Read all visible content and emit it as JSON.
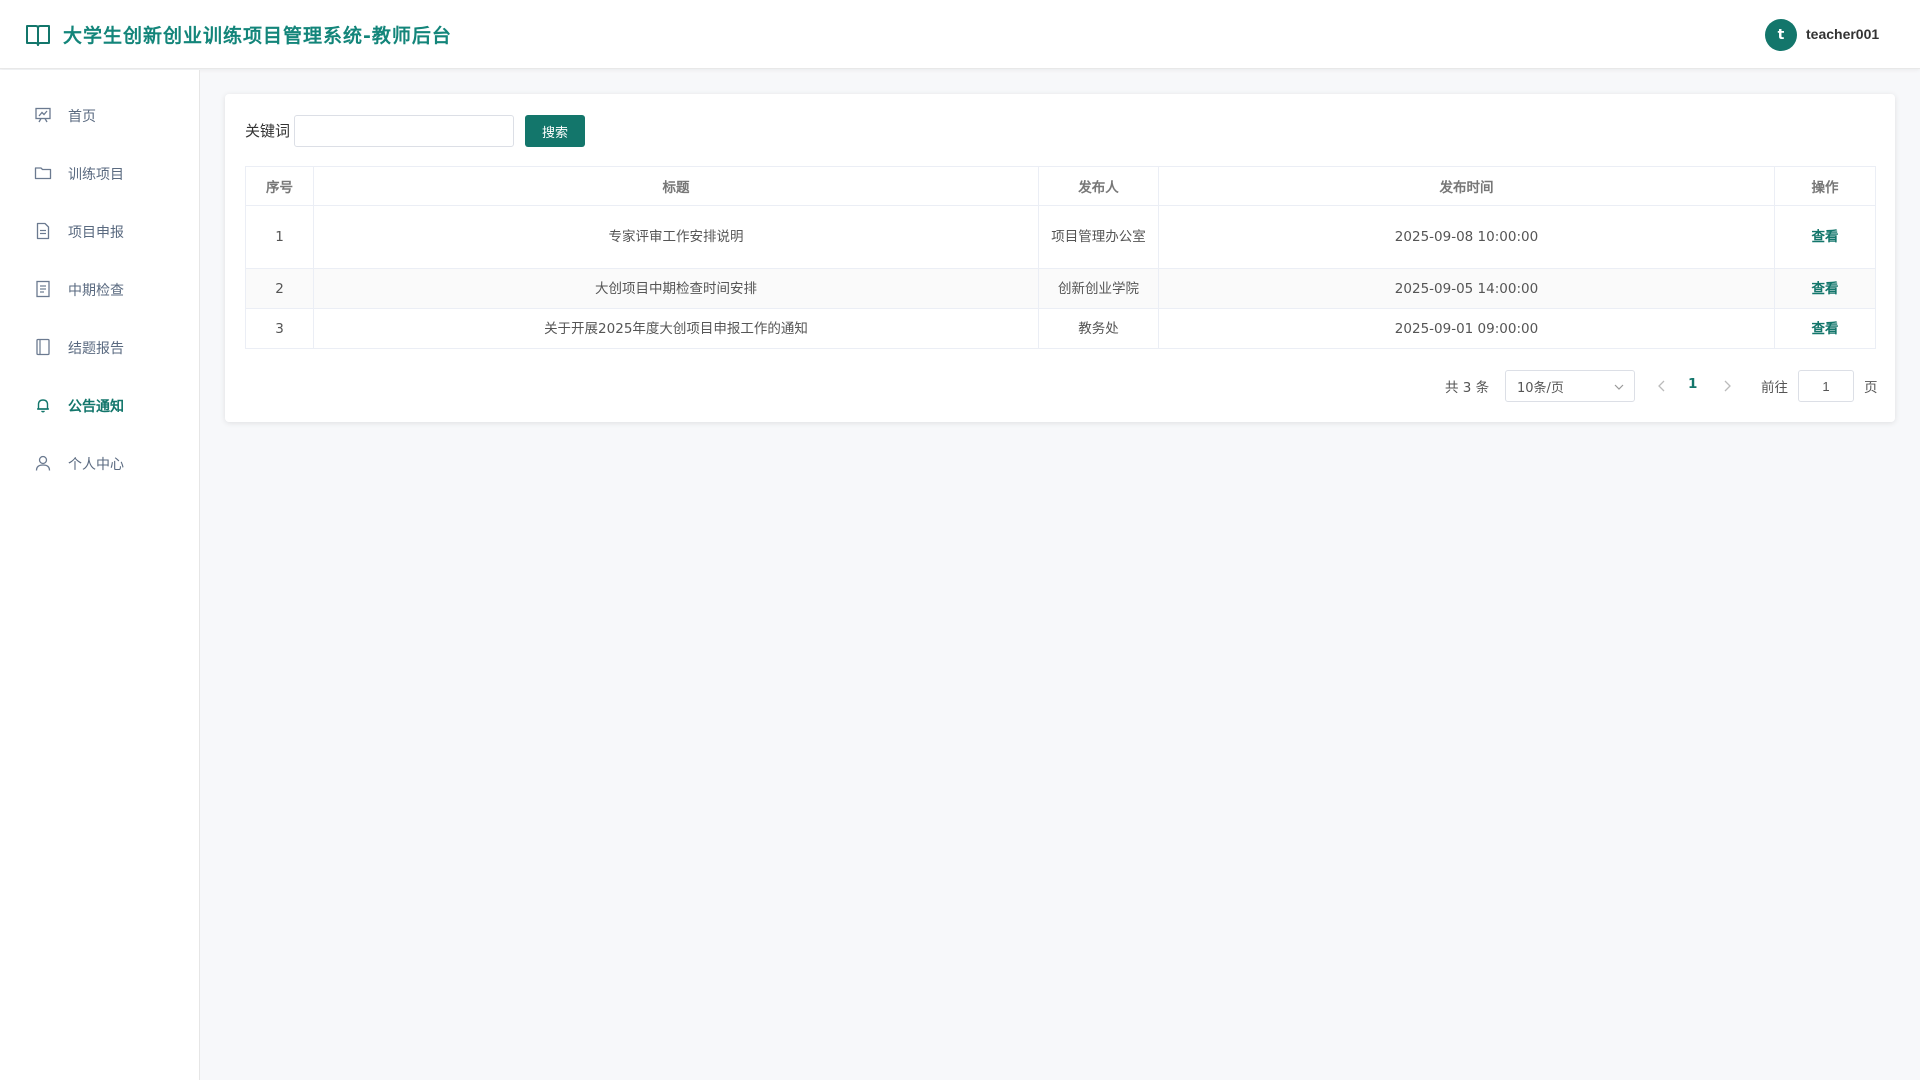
{
  "header": {
    "title": "大学生创新创业训练项目管理系统-教师后台",
    "avatar_letter": "t",
    "username": "teacher001"
  },
  "sidebar": {
    "items": [
      {
        "label": "首页",
        "icon": "presentation-icon"
      },
      {
        "label": "训练项目",
        "icon": "folder-icon"
      },
      {
        "label": "项目申报",
        "icon": "document-icon"
      },
      {
        "label": "中期检查",
        "icon": "checklist-icon"
      },
      {
        "label": "结题报告",
        "icon": "book-icon"
      },
      {
        "label": "公告通知",
        "icon": "bell-icon",
        "active": true
      },
      {
        "label": "个人中心",
        "icon": "user-icon"
      }
    ]
  },
  "search": {
    "label": "关键词",
    "placeholder": "",
    "value": "",
    "button_label": "搜索"
  },
  "table": {
    "columns": [
      "序号",
      "标题",
      "发布人",
      "发布时间",
      "操作"
    ],
    "rows": [
      {
        "index": "1",
        "title": "专家评审工作安排说明",
        "publisher": "项目管理办公室",
        "time": "2025-09-08 10:00:00",
        "action": "查看"
      },
      {
        "index": "2",
        "title": "大创项目中期检查时间安排",
        "publisher": "创新创业学院",
        "time": "2025-09-05 14:00:00",
        "action": "查看"
      },
      {
        "index": "3",
        "title": "关于开展2025年度大创项目申报工作的通知",
        "publisher": "教务处",
        "time": "2025-09-01 09:00:00",
        "action": "查看"
      }
    ]
  },
  "pagination": {
    "total_text": "共 3 条",
    "page_size": "10条/页",
    "current_page": "1",
    "goto_label": "前往",
    "goto_value": "1",
    "page_suffix": "页"
  },
  "colors": {
    "accent": "#13766b",
    "title": "#13857a",
    "background": "#f7f8fa"
  }
}
